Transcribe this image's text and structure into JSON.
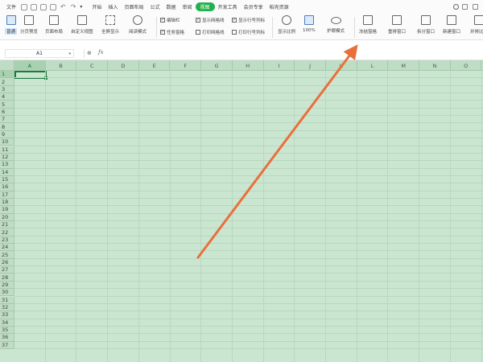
{
  "menubar": {
    "file": "文件",
    "tabs": [
      "开始",
      "插入",
      "页面布局",
      "公式",
      "数据",
      "审阅",
      "视图",
      "开发工具",
      "会员专享",
      "稻壳资源"
    ],
    "active_tab": "视图"
  },
  "ribbon": {
    "normal": "普通",
    "page_break_preview": "分页预览",
    "page_layout": "页面布局",
    "custom_view": "自定义视图",
    "full_screen": "全屏显示",
    "reading_mode": "阅读模式",
    "checks": {
      "edit_bar": "编辑栏",
      "task_pane": "任务窗格",
      "show_gridlines": "显示网格线",
      "print_gridlines": "打印网格线",
      "show_row_col_headers": "显示行号列标",
      "print_row_col_headers": "打印行号列标"
    },
    "zoom": "显示比例",
    "zoom_100": "100%",
    "eye_protection": "护眼模式",
    "freeze_panes": "冻结窗格",
    "rearrange_windows": "重排窗口",
    "split_window": "拆分窗口",
    "new_window": "新建窗口",
    "side_by_side": "并排比较"
  },
  "formula_bar": {
    "cell_ref": "A1",
    "fx": "fx",
    "value": ""
  },
  "grid": {
    "columns": [
      "A",
      "B",
      "C",
      "D",
      "E",
      "F",
      "G",
      "H",
      "I",
      "J",
      "K",
      "L",
      "M",
      "N",
      "O"
    ],
    "rows": [
      "1",
      "2",
      "3",
      "4",
      "5",
      "6",
      "7",
      "8",
      "9",
      "10",
      "11",
      "12",
      "13",
      "14",
      "15",
      "16",
      "17",
      "18",
      "19",
      "20",
      "21",
      "22",
      "23",
      "24",
      "25",
      "26",
      "27",
      "28",
      "29",
      "30",
      "31",
      "32",
      "33",
      "34",
      "35",
      "36",
      "37"
    ],
    "background_color": "#cbe6d0"
  },
  "annotation": {
    "arrow_color": "#e8703a"
  },
  "colors": {
    "active_tab": "#22b14c",
    "selection": "#1c7a3d"
  }
}
